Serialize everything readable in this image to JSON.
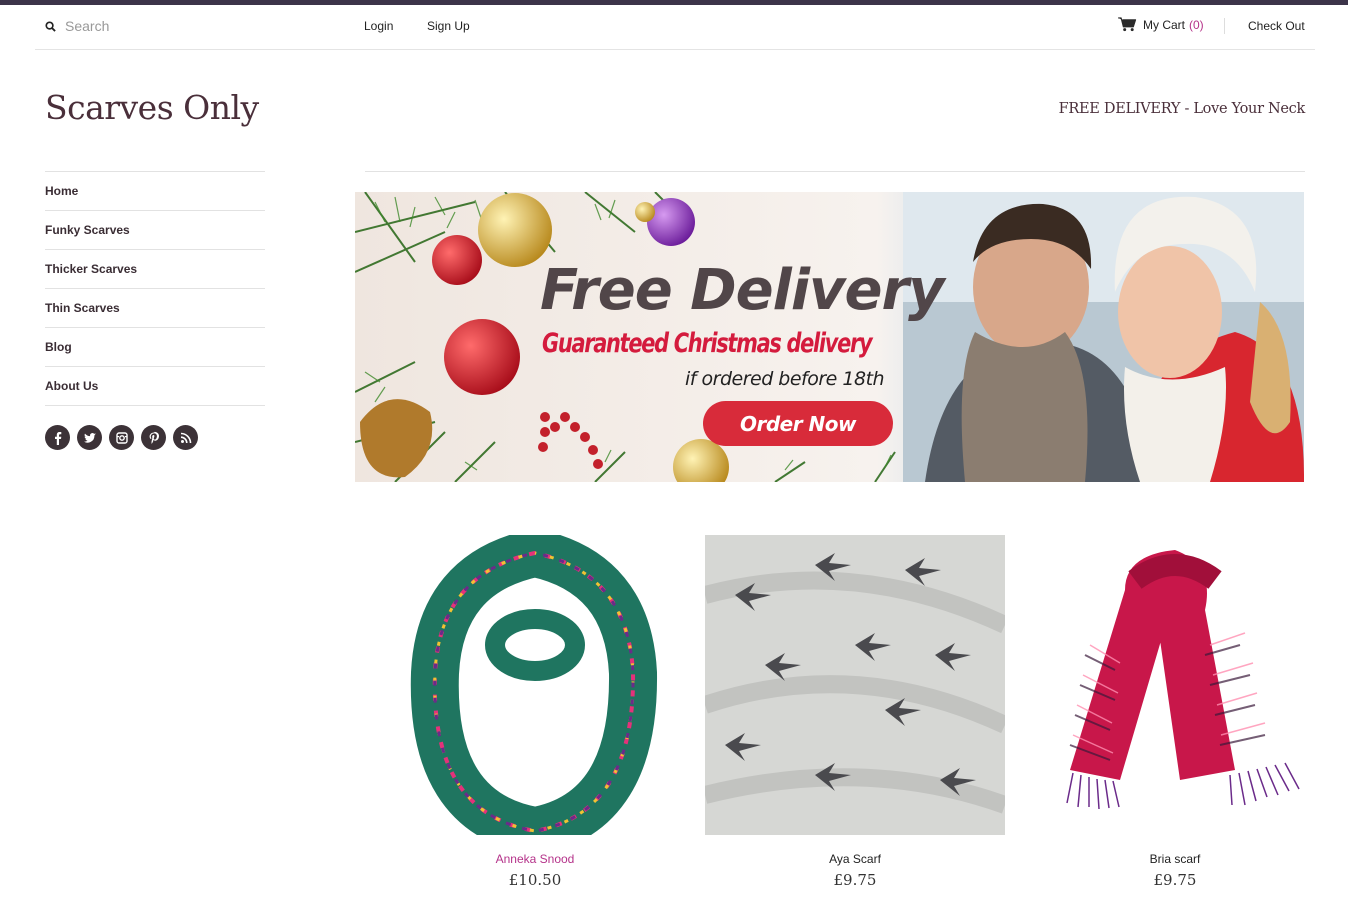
{
  "topbar": {
    "search_placeholder": "Search",
    "login": "Login",
    "signup": "Sign Up",
    "cart_label": "My Cart",
    "cart_count": "(0)",
    "checkout": "Check Out"
  },
  "header": {
    "brand": "Scarves Only",
    "tagline": "FREE DELIVERY - Love Your Neck"
  },
  "sidebar": {
    "items": [
      {
        "label": "Home"
      },
      {
        "label": "Funky Scarves"
      },
      {
        "label": "Thicker Scarves"
      },
      {
        "label": "Thin Scarves"
      },
      {
        "label": "Blog"
      },
      {
        "label": "About Us"
      }
    ],
    "social_icons": [
      "facebook-icon",
      "twitter-icon",
      "instagram-icon",
      "pinterest-icon",
      "rss-icon"
    ]
  },
  "banner": {
    "title": "Free Delivery",
    "subtitle": "Guaranteed Christmas delivery",
    "note": "if ordered before 18th",
    "button": "Order Now"
  },
  "products": [
    {
      "name": "Anneka Snood",
      "price": "£10.50"
    },
    {
      "name": "Aya Scarf",
      "price": "£9.75"
    },
    {
      "name": "Bria scarf",
      "price": "£9.75"
    }
  ],
  "colors": {
    "accent": "#b5338a",
    "top_stripe": "#3c3449",
    "brand_text": "#4a2f3a",
    "banner_button": "#d82b3a"
  }
}
